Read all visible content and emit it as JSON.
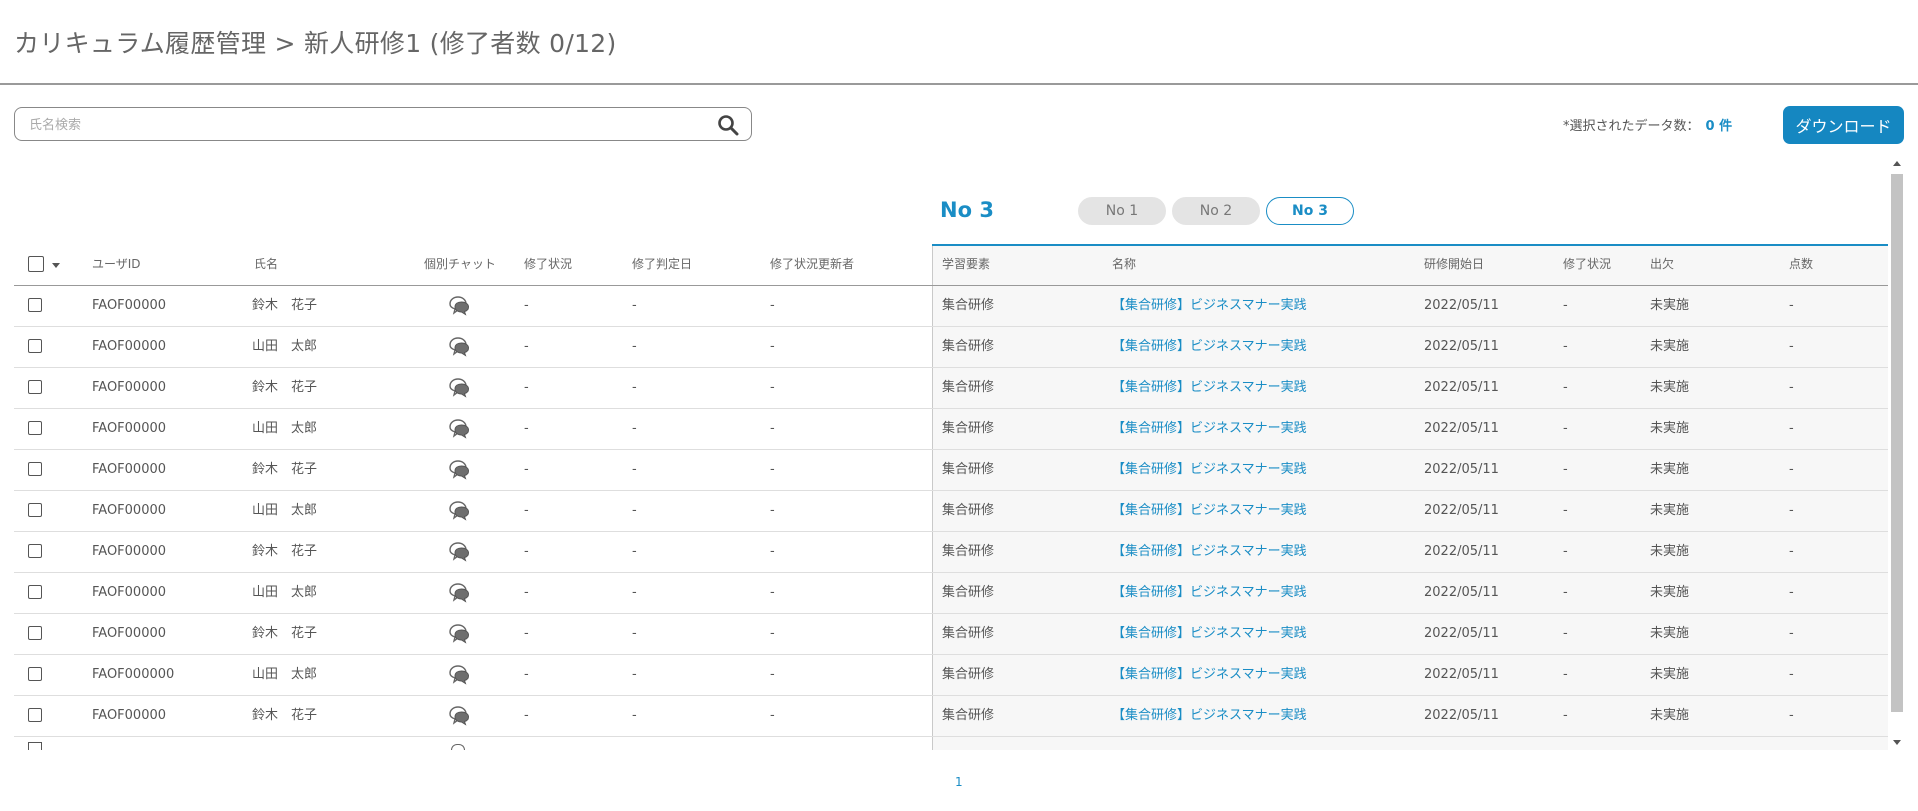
{
  "header": {
    "title": "カリキュラム履歴管理 > 新人研修1 (修了者数 0/12)"
  },
  "search": {
    "placeholder": "氏名検索",
    "icon": "search-icon"
  },
  "selection": {
    "label": "*選択されたデータ数：",
    "value": "0 件"
  },
  "toolbar": {
    "download_label": "ダウンロード"
  },
  "no_switcher": {
    "current_label": "No 3",
    "tabs": [
      {
        "label": "No 1",
        "active": false
      },
      {
        "label": "No 2",
        "active": false
      },
      {
        "label": "No 3",
        "active": true
      }
    ]
  },
  "table": {
    "columns": [
      "ユーザID",
      "氏名",
      "個別チャット",
      "修了状況",
      "修了判定日",
      "修了状況更新者",
      "学習要素",
      "名称",
      "研修開始日",
      "修了状況",
      "出欠",
      "点数"
    ],
    "rows": [
      {
        "user_id": "FAOF00000",
        "name": "鈴木　花子",
        "status": "-",
        "judge_date": "-",
        "updater": "-",
        "element": "集合研修",
        "title": "【集合研修】ビジネスマナー実践",
        "start_date": "2022/05/11",
        "status2": "-",
        "attendance": "未実施",
        "score": "-"
      },
      {
        "user_id": "FAOF00000",
        "name": "山田　太郎",
        "status": "-",
        "judge_date": "-",
        "updater": "-",
        "element": "集合研修",
        "title": "【集合研修】ビジネスマナー実践",
        "start_date": "2022/05/11",
        "status2": "-",
        "attendance": "未実施",
        "score": "-"
      },
      {
        "user_id": "FAOF00000",
        "name": "鈴木　花子",
        "status": "-",
        "judge_date": "-",
        "updater": "-",
        "element": "集合研修",
        "title": "【集合研修】ビジネスマナー実践",
        "start_date": "2022/05/11",
        "status2": "-",
        "attendance": "未実施",
        "score": "-"
      },
      {
        "user_id": "FAOF00000",
        "name": "山田　太郎",
        "status": "-",
        "judge_date": "-",
        "updater": "-",
        "element": "集合研修",
        "title": "【集合研修】ビジネスマナー実践",
        "start_date": "2022/05/11",
        "status2": "-",
        "attendance": "未実施",
        "score": "-"
      },
      {
        "user_id": "FAOF00000",
        "name": "鈴木　花子",
        "status": "-",
        "judge_date": "-",
        "updater": "-",
        "element": "集合研修",
        "title": "【集合研修】ビジネスマナー実践",
        "start_date": "2022/05/11",
        "status2": "-",
        "attendance": "未実施",
        "score": "-"
      },
      {
        "user_id": "FAOF00000",
        "name": "山田　太郎",
        "status": "-",
        "judge_date": "-",
        "updater": "-",
        "element": "集合研修",
        "title": "【集合研修】ビジネスマナー実践",
        "start_date": "2022/05/11",
        "status2": "-",
        "attendance": "未実施",
        "score": "-"
      },
      {
        "user_id": "FAOF00000",
        "name": "鈴木　花子",
        "status": "-",
        "judge_date": "-",
        "updater": "-",
        "element": "集合研修",
        "title": "【集合研修】ビジネスマナー実践",
        "start_date": "2022/05/11",
        "status2": "-",
        "attendance": "未実施",
        "score": "-"
      },
      {
        "user_id": "FAOF00000",
        "name": "山田　太郎",
        "status": "-",
        "judge_date": "-",
        "updater": "-",
        "element": "集合研修",
        "title": "【集合研修】ビジネスマナー実践",
        "start_date": "2022/05/11",
        "status2": "-",
        "attendance": "未実施",
        "score": "-"
      },
      {
        "user_id": "FAOF00000",
        "name": "鈴木　花子",
        "status": "-",
        "judge_date": "-",
        "updater": "-",
        "element": "集合研修",
        "title": "【集合研修】ビジネスマナー実践",
        "start_date": "2022/05/11",
        "status2": "-",
        "attendance": "未実施",
        "score": "-"
      },
      {
        "user_id": "FAOF000000",
        "name": "山田　太郎",
        "status": "-",
        "judge_date": "-",
        "updater": "-",
        "element": "集合研修",
        "title": "【集合研修】ビジネスマナー実践",
        "start_date": "2022/05/11",
        "status2": "-",
        "attendance": "未実施",
        "score": "-"
      },
      {
        "user_id": "FAOF00000",
        "name": "鈴木　花子",
        "status": "-",
        "judge_date": "-",
        "updater": "-",
        "element": "集合研修",
        "title": "【集合研修】ビジネスマナー実践",
        "start_date": "2022/05/11",
        "status2": "-",
        "attendance": "未実施",
        "score": "-"
      }
    ]
  },
  "pagination": {
    "current_page": "1"
  },
  "colors": {
    "accent": "#1a8dc5",
    "button": "#1587c1",
    "divider": "#9a9a9a"
  }
}
